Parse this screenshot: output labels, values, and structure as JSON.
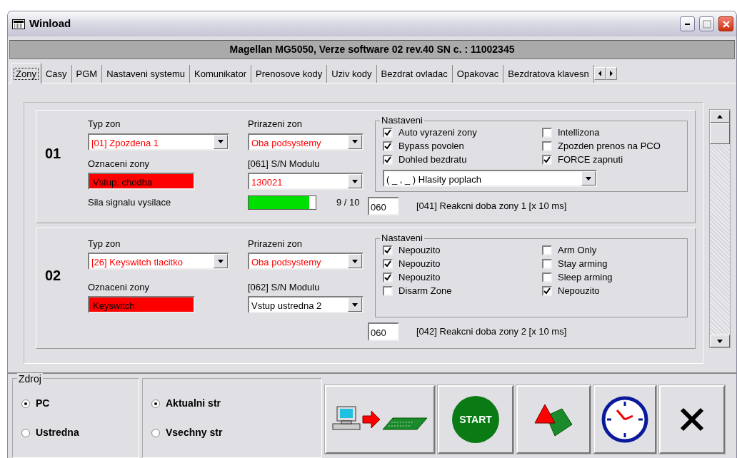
{
  "window": {
    "title": "Winload",
    "header": "Magellan MG5050, Verze software 02 rev.40 SN c. : 11002345"
  },
  "tabs": [
    {
      "label": "Zony",
      "selected": true
    },
    {
      "label": "Casy",
      "selected": false
    },
    {
      "label": "PGM",
      "selected": false
    },
    {
      "label": "Nastaveni systemu",
      "selected": false
    },
    {
      "label": "Komunikator",
      "selected": false
    },
    {
      "label": "Prenosove kody",
      "selected": false
    },
    {
      "label": "Uziv kody",
      "selected": false
    },
    {
      "label": "Bezdrat ovladac",
      "selected": false
    },
    {
      "label": "Opakovac",
      "selected": false
    },
    {
      "label": "Bezdratova klavesn",
      "selected": false
    }
  ],
  "zones": [
    {
      "number": "01",
      "type": {
        "label": "Typ zon",
        "value": "[01] Zpozdena 1",
        "changed": true
      },
      "name": {
        "label": "Oznaceni zony",
        "value": "Vstup. chodba"
      },
      "assign": {
        "label": "Prirazeni zon",
        "value": "Oba podsystemy",
        "changed": true
      },
      "module": {
        "label": "[061] S/N Modulu",
        "value": "130021",
        "changed": true
      },
      "signal": {
        "label": "Sila signalu vysilace",
        "level": 0.9,
        "reading": "9 / 10"
      },
      "settings": {
        "title": "Nastaveni",
        "options": [
          {
            "label": "Auto vyrazeni zony",
            "checked": true
          },
          {
            "label": "Intellizona",
            "checked": false
          },
          {
            "label": "Bypass povolen",
            "checked": true
          },
          {
            "label": "Zpozden prenos na PCO",
            "checked": false
          },
          {
            "label": "Dohled bezdratu",
            "checked": true
          },
          {
            "label": "FORCE zapnuti",
            "checked": true
          }
        ],
        "alarm": "( _ , _ ) Hlasity poplach"
      },
      "reaction": {
        "value": "060",
        "label": "[041] Reakcni doba zony 1 [x 10 ms]"
      }
    },
    {
      "number": "02",
      "type": {
        "label": "Typ zon",
        "value": "[26] Keyswitch tlacitko",
        "changed": true
      },
      "name": {
        "label": "Oznaceni zony",
        "value": "Keyswitch"
      },
      "assign": {
        "label": "Prirazeni zon",
        "value": "Oba podsystemy",
        "changed": true
      },
      "module": {
        "label": "[062] S/N Modulu",
        "value": "Vstup ustredna 2",
        "changed": false
      },
      "settings": {
        "title": "Nastaveni",
        "options": [
          {
            "label": "Nepouzito",
            "checked": true
          },
          {
            "label": "Arm Only",
            "checked": false
          },
          {
            "label": "Nepouzito",
            "checked": true
          },
          {
            "label": "Stay arming",
            "checked": false
          },
          {
            "label": "Nepouzito",
            "checked": true
          },
          {
            "label": "Sleep arming",
            "checked": false
          },
          {
            "label": "Disarm Zone",
            "checked": false
          },
          {
            "label": "Nepouzito",
            "checked": true
          }
        ]
      },
      "reaction": {
        "value": "060",
        "label": "[042] Reakcni doba zony 2 [x 10 ms]"
      }
    }
  ],
  "source": {
    "title": "Zdroj",
    "options": [
      {
        "label": "PC",
        "selected": true
      },
      {
        "label": "Ustredna",
        "selected": false
      }
    ]
  },
  "pages": {
    "options": [
      {
        "label": "Aktualni str",
        "selected": true
      },
      {
        "label": "Vsechny str",
        "selected": false
      }
    ]
  },
  "start_button": {
    "label": "START"
  }
}
